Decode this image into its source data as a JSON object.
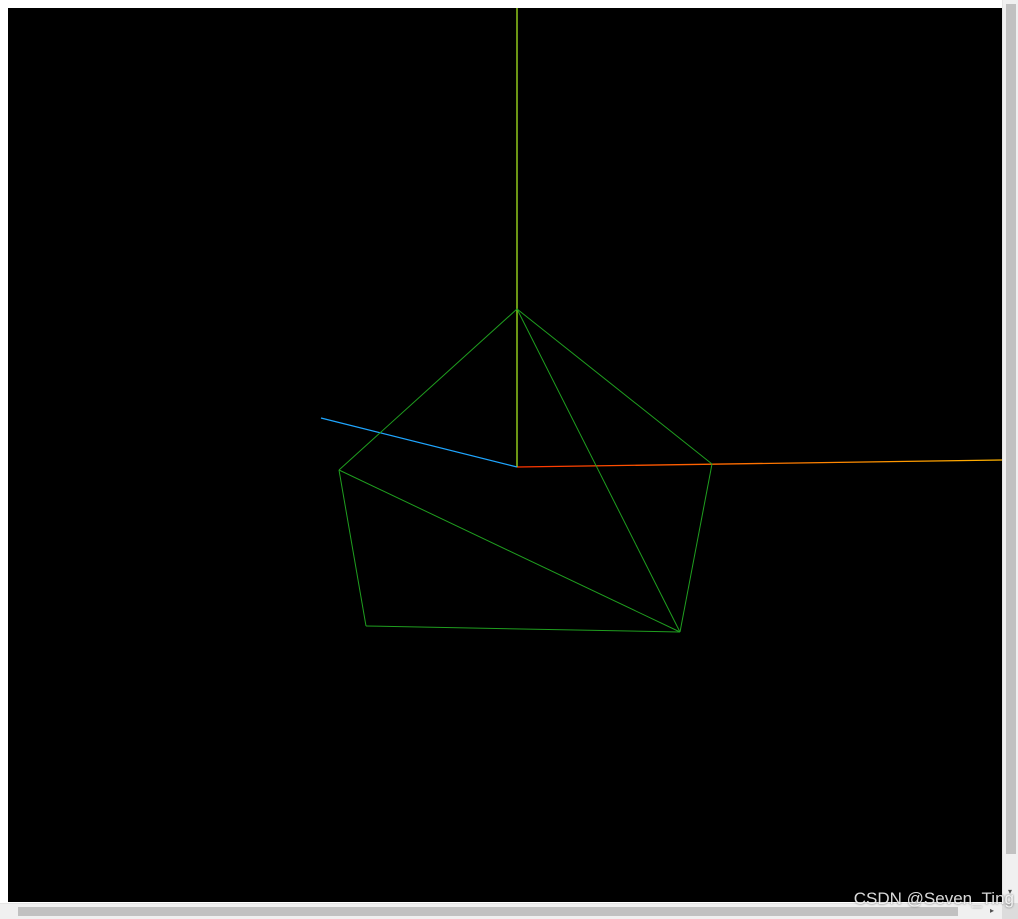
{
  "scene": {
    "background_color": "#000000",
    "mesh_color": "#1f9e1f",
    "axes": {
      "x_color_start": "#ff3300",
      "x_color_end": "#ffb300",
      "y_color": "#a6e61f",
      "z_color": "#1fa6ff"
    }
  },
  "watermark": {
    "text": "CSDN @Seven_Ting"
  },
  "scrollbars": {
    "down_arrow": "▾",
    "right_arrow": "▸"
  }
}
